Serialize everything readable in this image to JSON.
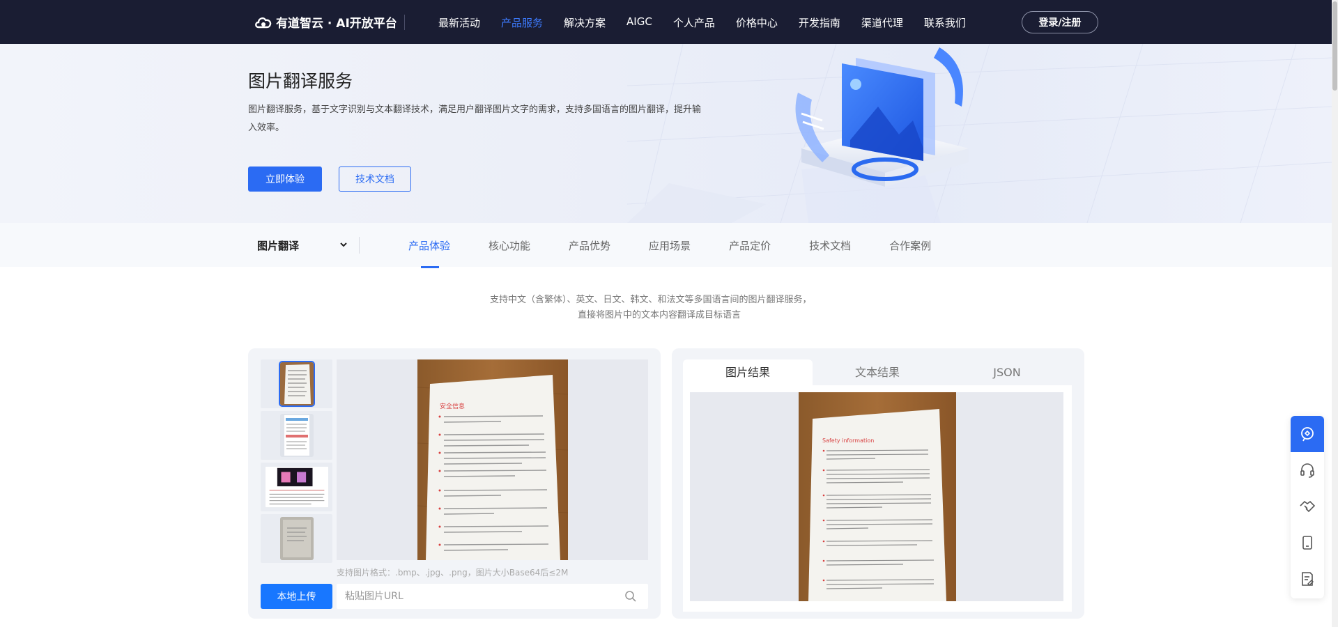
{
  "nav": {
    "logo": "有道智云 · AI开放平台",
    "items": [
      {
        "label": "最新活动",
        "active": false
      },
      {
        "label": "产品服务",
        "active": true
      },
      {
        "label": "解决方案",
        "active": false
      },
      {
        "label": "AIGC",
        "active": false
      },
      {
        "label": "个人产品",
        "active": false
      },
      {
        "label": "价格中心",
        "active": false
      },
      {
        "label": "开发指南",
        "active": false
      },
      {
        "label": "渠道代理",
        "active": false
      },
      {
        "label": "联系我们",
        "active": false
      }
    ],
    "login": "登录/注册"
  },
  "hero": {
    "title": "图片翻译服务",
    "description": "图片翻译服务，基于文字识别与文本翻译技术，满足用户翻译图片文字的需求，支持多国语言的图片翻译，提升输入效率。",
    "primary_button": "立即体验",
    "secondary_button": "技术文档"
  },
  "subnav": {
    "selector": "图片翻译",
    "tabs": [
      {
        "label": "产品体验",
        "active": true
      },
      {
        "label": "核心功能",
        "active": false
      },
      {
        "label": "产品优势",
        "active": false
      },
      {
        "label": "应用场景",
        "active": false
      },
      {
        "label": "产品定价",
        "active": false
      },
      {
        "label": "技术文档",
        "active": false
      },
      {
        "label": "合作案例",
        "active": false
      }
    ]
  },
  "intro": {
    "line1": "支持中文（含繁体）、英文、日文、韩文、和法文等多国语言间的图片翻译服务，",
    "line2": "直接将图片中的文本内容翻译成目标语言"
  },
  "demo": {
    "format_hint": "支持图片格式：.bmp、.jpg、.png，图片大小Base64后≤2M",
    "upload_button": "本地上传",
    "url_placeholder": "粘贴图片URL",
    "source_doc": {
      "title": "安全信息"
    },
    "result_tabs": [
      {
        "label": "图片结果",
        "active": true
      },
      {
        "label": "文本结果",
        "active": false
      },
      {
        "label": "JSON",
        "active": false
      }
    ],
    "result_doc": {
      "title": "Safety information"
    }
  },
  "float_toolbar": [
    "assistant-icon",
    "headset-icon",
    "handshake-icon",
    "mobile-icon",
    "feedback-icon"
  ],
  "colors": {
    "nav_bg": "#1a1d33",
    "accent": "#2b6bf3",
    "upload": "#1877ff"
  }
}
